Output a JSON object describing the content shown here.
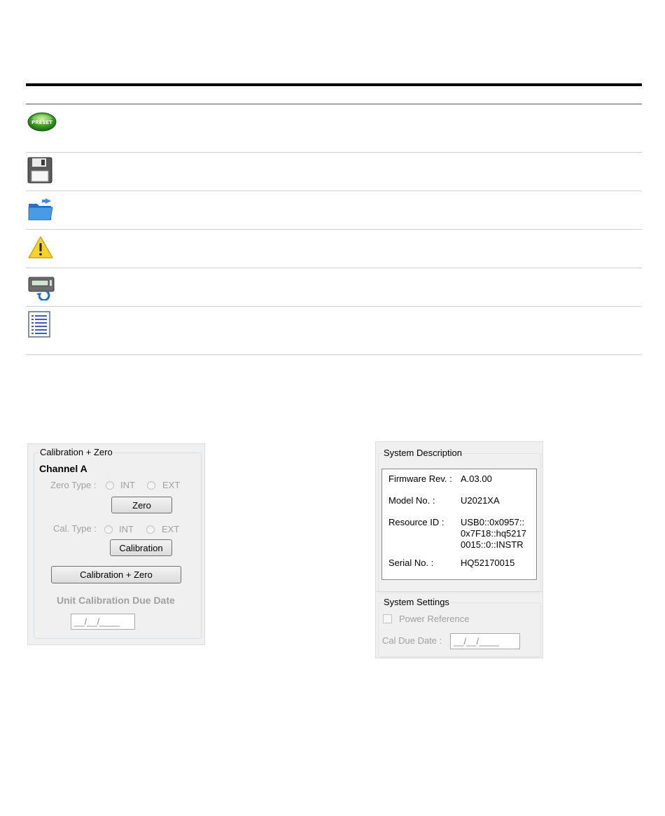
{
  "icons": [
    {
      "name": "preset-icon",
      "label": "PRESET"
    },
    {
      "name": "save-icon"
    },
    {
      "name": "open-folder-icon"
    },
    {
      "name": "warning-icon"
    },
    {
      "name": "instrument-reset-icon"
    },
    {
      "name": "log-list-icon"
    }
  ],
  "calibration_panel": {
    "title": "Calibration + Zero",
    "channel": "Channel A",
    "zero_type_label": "Zero Type :",
    "int_label": "INT",
    "ext_label": "EXT",
    "zero_button": "Zero",
    "cal_type_label": "Cal. Type :",
    "calibration_button": "Calibration",
    "cal_zero_button": "Calibration + Zero",
    "due_date_label": "Unit Calibration Due Date",
    "due_date_value": "__/__/____"
  },
  "system_panel": {
    "description_title": "System Description",
    "firmware_label": "Firmware Rev. :",
    "firmware_value": "A.03.00",
    "model_label": "Model No. :",
    "model_value": "U2021XA",
    "resource_label": "Resource ID :",
    "resource_line1": "USB0::0x0957::",
    "resource_line2": "0x7F18::hq5217",
    "resource_line3": "0015::0::INSTR",
    "serial_label": "Serial No. :",
    "serial_value": "HQ52170015",
    "settings_title": "System Settings",
    "power_reference_label": "Power Reference",
    "cal_due_label": "Cal Due Date :",
    "cal_due_value": "__/__/____"
  }
}
